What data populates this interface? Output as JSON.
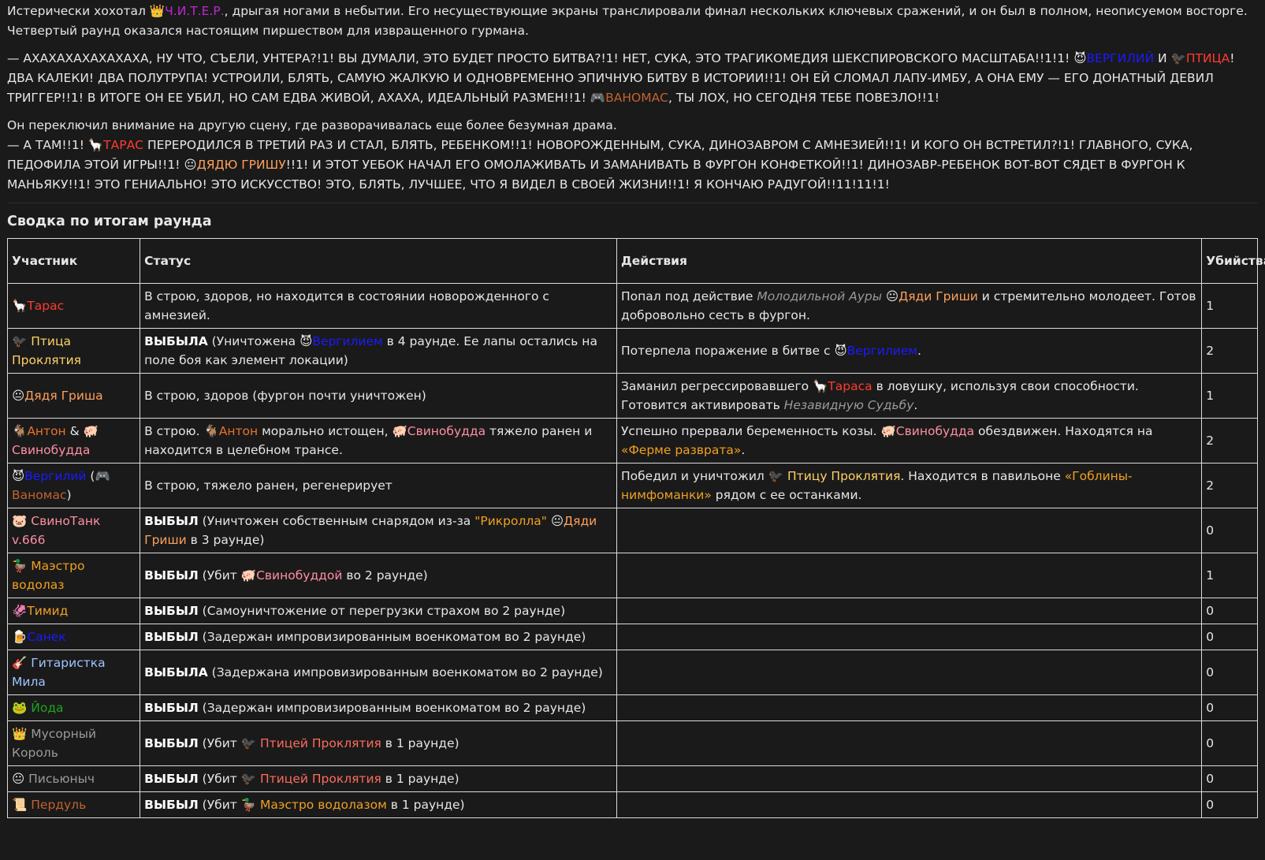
{
  "colors": {
    "background": "#1a1a1a",
    "text": "#e6e6e6",
    "border": "#dcdcdc"
  },
  "icons": {
    "crown": "👑",
    "devil": "😈",
    "bird": "🐦‍⬛",
    "gamepad": "🎮",
    "llama": "🦙",
    "baby": "👶",
    "goat": "🐐",
    "pig": "🐖",
    "pig_face": "🐷",
    "duck": "🦆",
    "squid": "🦑",
    "beer": "🍺",
    "guitar": "🎸",
    "frog": "🐸",
    "face": "😐",
    "scroll": "📜"
  },
  "story": {
    "p1_a": "Истерически хохотал ",
    "p1_icon": "👑",
    "p1_name": "Ч.И.Т.Е.Р.",
    "p1_b": ", дрыгая ногами в небытии. Его несуществующие экраны транслировали финал нескольких ключевых сражений, и он был в полном, неописуемом восторге. Четвертый раунд оказался настоящим пиршеством для извращенного гурмана.",
    "p2_a": "— АХАХАХАХАХАХАХА, НУ ЧТО, СЪЕЛИ, УНТЕРА?!1! ВЫ ДУМАЛИ, ЭТО БУДЕТ ПРОСТО БИТВА?!1! НЕТ, СУКА, ЭТО ТРАГИКОМЕДИЯ ШЕКСПИРОВСКОГО МАСШТАБА!!1!1! ",
    "p2_icon1": "😈",
    "p2_name1": "ВЕРГИЛИЙ",
    "p2_and": " И ",
    "p2_icon2": "🐦‍⬛",
    "p2_name2": "ПТИЦА",
    "p2_b": "! ДВА КАЛЕКИ! ДВА ПОЛУТРУПА! УСТРОИЛИ, БЛЯТЬ, САМУЮ ЖАЛКУЮ И ОДНОВРЕМЕННО ЭПИЧНУЮ БИТВУ В ИСТОРИИ!!1! ОН ЕЙ СЛОМАЛ ЛАПУ-ИМБУ, А ОНА ЕМУ — ЕГО ДОНАТНЫЙ ДЕВИЛ ТРИГГЕР!!1! В ИТОГЕ ОН ЕЕ УБИЛ, НО САМ ЕДВА ЖИВОЙ, АХАХА, ИДЕАЛЬНЫЙ РАЗМЕН!!1! ",
    "p2_icon3": "🎮",
    "p2_name3": "ВАНОМАС",
    "p2_c": ", ТЫ ЛОХ, НО СЕГОДНЯ ТЕБЕ ПОВЕЗЛО!!1!",
    "p3_line1": "Он переключил внимание на другую сцену, где разворачивалась еще более безумная драма.",
    "p3_a": "— А ТАМ!!1! ",
    "p3_icon1": "🦙",
    "p3_name1": "ТАРАС",
    "p3_b": " ПЕРЕРОДИЛСЯ В ТРЕТИЙ РАЗ И СТАЛ, БЛЯТЬ, РЕБЕНКОМ!!1! НОВОРОЖДЕННЫМ, СУКА, ДИНОЗАВРОМ С АМНЕЗИЕЙ!!1! И КОГО ОН ВСТРЕТИЛ?!1! ГЛАВНОГО, СУКА, ПЕДОФИЛА ЭТОЙ ИГРЫ!!1! ",
    "p3_icon2": "😐",
    "p3_name2": "ДЯДЮ ГРИШУ",
    "p3_c": "!!1! И ЭТОТ УЕБОК НАЧАЛ ЕГО ОМОЛАЖИВАТЬ И ЗАМАНИВАТЬ В ФУРГОН КОНФЕТКОЙ!!1! ДИНОЗАВР-РЕБЕНОК ВОТ-ВОТ СЯДЕТ В ФУРГОН К МАНЬЯКУ!!1! ЭТО ГЕНИАЛЬНО! ЭТО ИСКУССТВО! ЭТО, БЛЯТЬ, ЛУЧШЕЕ, ЧТО Я ВИДЕЛ В СВОЕЙ ЖИЗНИ!!1! Я КОНЧАЮ РАДУГОЙ!!11!11!1!"
  },
  "summary": {
    "title": "Сводка по итогам раунда",
    "headers": {
      "participant": "Участник",
      "status": "Статус",
      "actions": "Действия",
      "kills": "Убийства"
    },
    "rows": {
      "r1": {
        "icon": "🦙",
        "name": "Тарас",
        "status": "В строю, здоров, но находится в состоянии новорожденного с амнезией.",
        "a1": "Попал под действие ",
        "a_it": "Молодильной Ауры",
        "a_icon": "😐",
        "a_name": "Дяди Гриши",
        "a2": " и стремительно молодеет. Готов добровольно сесть в фургон.",
        "kills": "1"
      },
      "r2": {
        "icon": "🐦‍⬛",
        "name": "Птица Проклятия",
        "s_bold": "ВЫБЫЛА",
        "s1": " (Уничтожена ",
        "s_icon": "😈",
        "s_name": "Вергилием",
        "s2": " в 4 раунде. Ее лапы остались на поле боя как элемент локации)",
        "a1": "Потерпела поражение в битве с ",
        "a_icon": "😈",
        "a_name": "Вергилием",
        "a2": ".",
        "kills": "2"
      },
      "r3": {
        "icon": "😐",
        "name": "Дядя Гриша",
        "status": "В строю, здоров (фургон почти уничтожен)",
        "a1": "Заманил регрессировавшего ",
        "a_icon": "🦙",
        "a_name": "Тараса",
        "a2": " в ловушку, используя свои способности. Готовится активировать ",
        "a_it": "Незавидную Судьбу",
        "a3": ".",
        "kills": "1"
      },
      "r4": {
        "icon1": "🐐",
        "name1": "Антон",
        "amp": " & ",
        "icon2": "🐖",
        "name2": "Свинобудда",
        "s1": "В строю. ",
        "s_icon1": "🐐",
        "s_name1": "Антон",
        "s2": " морально истощен, ",
        "s_icon2": "🐖",
        "s_name2": "Свинобудда",
        "s3": " тяжело ранен и находится в целебном трансе.",
        "a1": "Успешно прервали беременность козы. ",
        "a_icon": "🐖",
        "a_name": "Свинобудда",
        "a2": " обездвижен. Находятся на ",
        "a_place": "«Ферме разврата»",
        "a3": ".",
        "kills": "2"
      },
      "r5": {
        "icon1": "😈",
        "name1": "Вергилий",
        "open": " (",
        "icon2": "🎮",
        "name2": "Ваномас",
        "close": ")",
        "status": "В строю, тяжело ранен, регенерирует",
        "a1": "Победил и уничтожил ",
        "a_icon": "🐦‍⬛",
        "a_name": "Птицу Проклятия",
        "a2": ". Находится в павильоне ",
        "a_place": "«Гоблины-нимфоманки»",
        "a3": " рядом с ее останками.",
        "kills": "2"
      },
      "r6": {
        "icon": "🐷",
        "name": "СвиноТанк v.666",
        "s_bold": "ВЫБЫЛ",
        "s1": " (Уничтожен собственным снарядом из-за ",
        "s_q": "\"Рикролла\"",
        "s_sp": " ",
        "s_icon": "😐",
        "s_name": "Дяди Гриши",
        "s2": " в 3 раунде)",
        "kills": "0"
      },
      "r7": {
        "icon": "🦆",
        "name": "Маэстро водолаз",
        "s_bold": "ВЫБЫЛ",
        "s1": " (Убит ",
        "s_icon": "🐖",
        "s_name": "Свинобуддой",
        "s2": " во 2 раунде)",
        "kills": "1"
      },
      "r8": {
        "icon": "🦑",
        "name": "Тимид",
        "s_bold": "ВЫБЫЛ",
        "s1": " (Самоуничтожение от перегрузки страхом во 2 раунде)",
        "kills": "0"
      },
      "r9": {
        "icon": "🍺",
        "name": "Санек",
        "s_bold": "ВЫБЫЛ",
        "s1": " (Задержан импровизированным военкоматом во 2 раунде)",
        "kills": "0"
      },
      "r10": {
        "icon": "🎸",
        "name": "Гитаристка Мила",
        "s_bold": "ВЫБЫЛА",
        "s1": " (Задержана импровизированным военкоматом во 2 раунде)",
        "kills": "0"
      },
      "r11": {
        "icon": "🐸",
        "name": "Йода",
        "s_bold": "ВЫБЫЛ",
        "s1": " (Задержан импровизированным военкоматом во 2 раунде)",
        "kills": "0"
      },
      "r12": {
        "icon": "👑",
        "name": "Мусорный Король",
        "s_bold": "ВЫБЫЛ",
        "s1": " (Убит ",
        "s_icon": "🐦‍⬛",
        "s_name": "Птицей Проклятия",
        "s2": " в 1 раунде)",
        "kills": "0"
      },
      "r13": {
        "icon": "😐",
        "name": "Письюныч",
        "s_bold": "ВЫБЫЛ",
        "s1": " (Убит ",
        "s_icon": "🐦‍⬛",
        "s_name": "Птицей Проклятия",
        "s2": " в 1 раунде)",
        "kills": "0"
      },
      "r14": {
        "icon": "📜",
        "name": "Пердуль",
        "s_bold": "ВЫБЫЛ",
        "s1": " (Убит ",
        "s_icon": "🦆",
        "s_name": "Маэстро водолазом",
        "s2": " в 1 раунде)",
        "kills": "0"
      }
    }
  }
}
